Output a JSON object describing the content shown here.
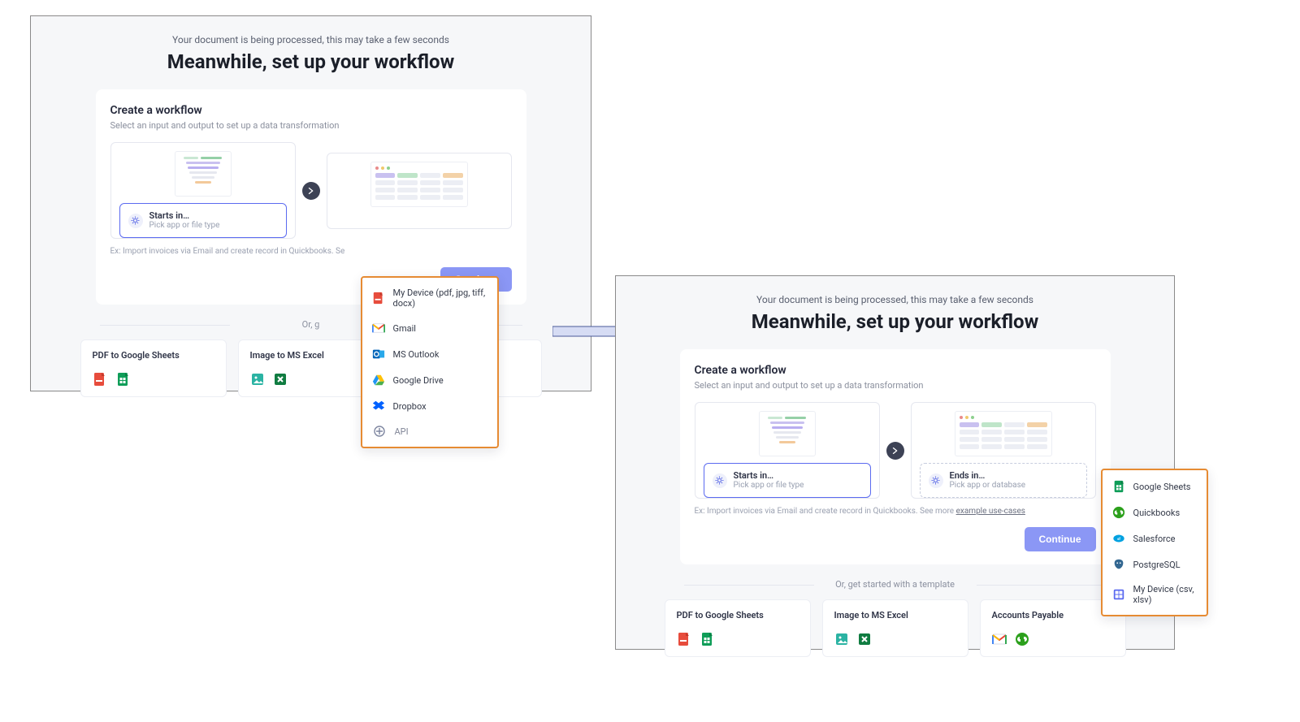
{
  "processing_text": "Your document is being processed, this may take a few seconds",
  "headline": "Meanwhile, set up your workflow",
  "card": {
    "title": "Create a workflow",
    "subtitle": "Select an input and output to set up a data transformation",
    "starts_in_label": "Starts in…",
    "starts_in_sub": "Pick app or file type",
    "ends_in_label": "Ends in…",
    "ends_in_sub": "Pick app or database",
    "example_prefix": "Ex: Import invoices via Email and create record in Quickbooks. ",
    "example_prefix_trunc": "Ex: Import invoices via Email and create record in Quickbooks. Se",
    "example_more_label": "See more",
    "example_link": "example use-cases",
    "continue": "Continue"
  },
  "or_line_full": "Or, get started with a template",
  "or_line_trunc": "Or, g",
  "input_menu": {
    "items": [
      {
        "label": "My Device (pdf, jpg, tiff, docx)",
        "icon": "pdf"
      },
      {
        "label": "Gmail",
        "icon": "gmail"
      },
      {
        "label": "MS Outlook",
        "icon": "outlook"
      },
      {
        "label": "Google Drive",
        "icon": "gdrive"
      },
      {
        "label": "Dropbox",
        "icon": "dropbox"
      }
    ],
    "tail": {
      "label": "API",
      "icon": "api"
    }
  },
  "output_menu": {
    "items": [
      {
        "label": "Google Sheets",
        "icon": "gsheets"
      },
      {
        "label": "Quickbooks",
        "icon": "quickbooks"
      },
      {
        "label": "Salesforce",
        "icon": "salesforce"
      },
      {
        "label": "PostgreSQL",
        "icon": "postgres"
      },
      {
        "label": "My Device (csv, xlsv)",
        "icon": "csv"
      }
    ]
  },
  "templates": [
    {
      "title": "PDF to Google Sheets",
      "icons": [
        "pdf",
        "gsheets"
      ]
    },
    {
      "title": "Image to MS Excel",
      "icons": [
        "image",
        "excel"
      ]
    },
    {
      "title": "Accounts Payable",
      "icons": [
        "gmail",
        "quickbooks"
      ]
    }
  ]
}
